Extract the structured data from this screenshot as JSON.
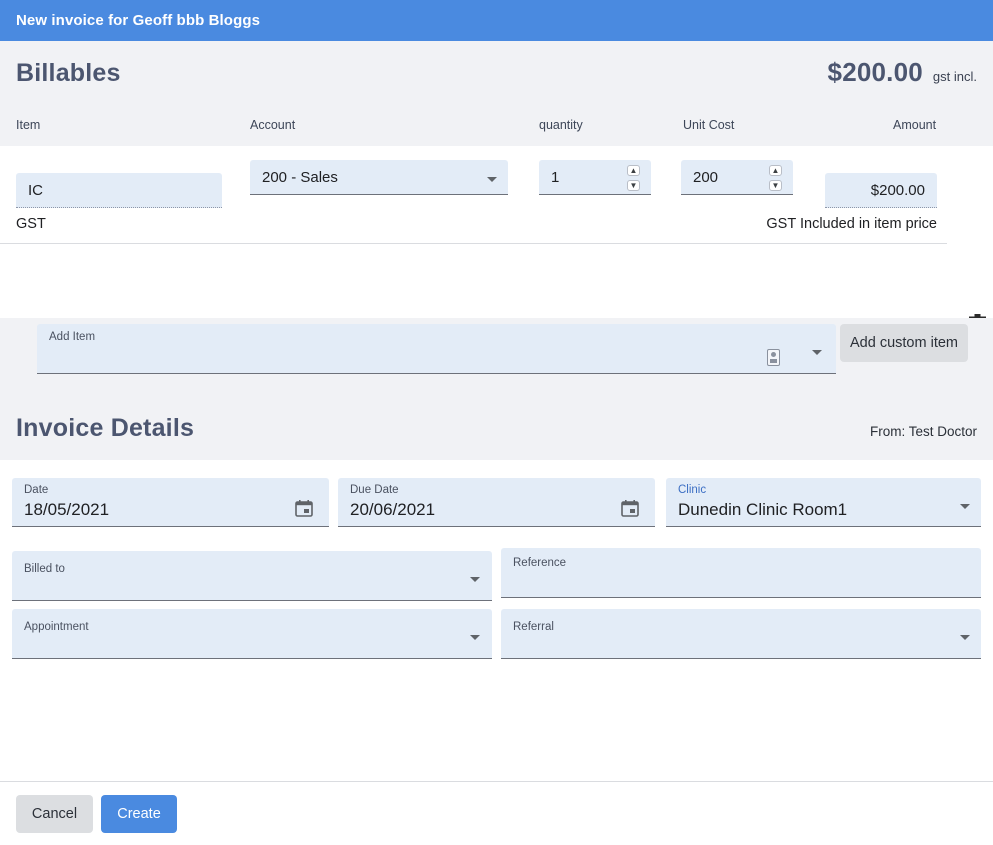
{
  "window": {
    "title": "New invoice for Geoff bbb Bloggs",
    "header_color": "#4a8ae0"
  },
  "billables": {
    "title": "Billables",
    "total": "$200.00",
    "total_note": "gst incl.",
    "columns": {
      "item": "Item",
      "account": "Account",
      "quantity": "quantity",
      "unit_cost": "Unit Cost",
      "amount": "Amount"
    },
    "rows": [
      {
        "item": "IC",
        "account": "200 - Sales",
        "quantity": "1",
        "unit_cost": "200",
        "amount": "$200.00",
        "tax_label": "GST",
        "tax_note": "GST Included in item price",
        "delete_icon": "trash-icon"
      }
    ],
    "add_item_label": "Add Item",
    "add_item_value": "",
    "add_custom_item_label": "Add custom item"
  },
  "invoice_details": {
    "title": "Invoice Details",
    "from": "From: Test Doctor",
    "fields": {
      "date": {
        "label": "Date",
        "value": "18/05/2021",
        "icon": "calendar-icon"
      },
      "due_date": {
        "label": "Due Date",
        "value": "20/06/2021",
        "icon": "calendar-icon"
      },
      "clinic": {
        "label": "Clinic",
        "value": "Dunedin Clinic Room1"
      },
      "billed_to": {
        "label": "Billed to",
        "value": ""
      },
      "reference": {
        "label": "Reference",
        "value": ""
      },
      "appointment": {
        "label": "Appointment",
        "value": ""
      },
      "referral": {
        "label": "Referral",
        "value": ""
      }
    }
  },
  "footer": {
    "cancel_label": "Cancel",
    "create_label": "Create"
  }
}
